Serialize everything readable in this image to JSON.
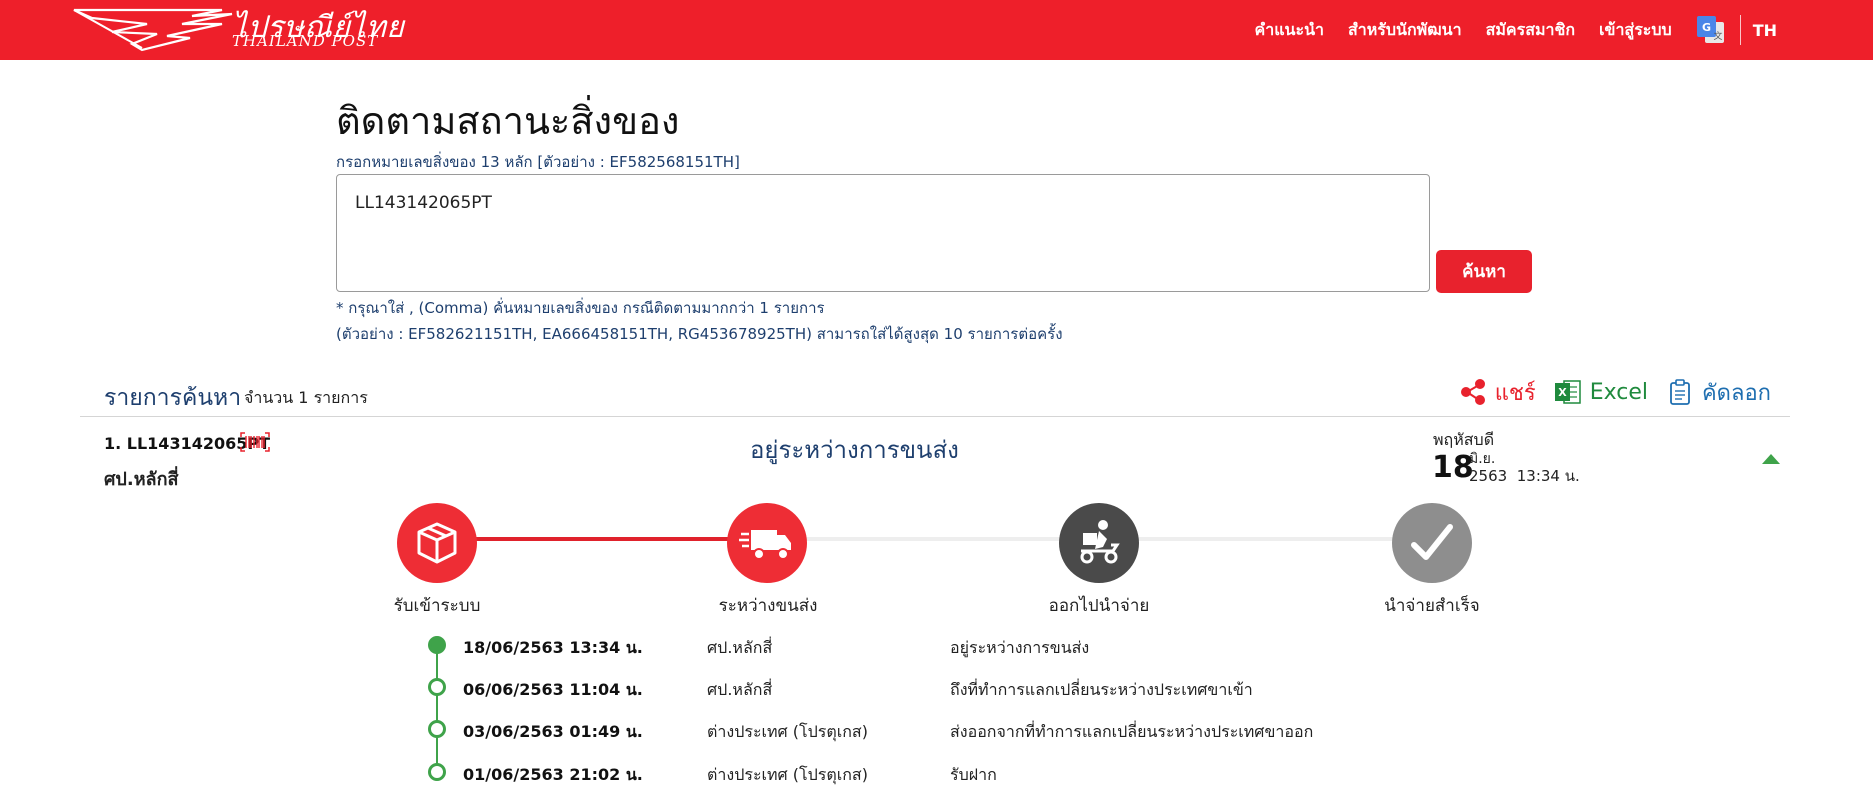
{
  "header": {
    "logo_th": "ไปรษณีย์ไทย",
    "logo_en": "THAILAND POST",
    "nav": [
      "คำแนะนำ",
      "สำหรับนักพัฒนา",
      "สมัครสมาชิก",
      "เข้าสู่ระบบ"
    ],
    "translate_icon": "google-translate-icon",
    "lang": "TH",
    "colors": {
      "brand_red": "#ee1f2a"
    }
  },
  "search": {
    "title": "ติดตามสถานะสิ่งของ",
    "hint": "กรอกหมายเลขสิ่งของ 13 หลัก [ตัวอย่าง : EF582568151TH]",
    "value": "LL143142065PT",
    "button": "ค้นหา",
    "note1": "* กรุณาใส่ , (Comma) คั่นหมายเลขสิ่งของ กรณีติดตามมากกว่า 1 รายการ",
    "note2": "(ตัวอย่าง : EF582621151TH, EA666458151TH, RG453678925TH) สามารถใส่ได้สูงสุด 10 รายการต่อครั้ง"
  },
  "results": {
    "title": "รายการค้นหา",
    "count": "จำนวน 1 รายการ",
    "actions": {
      "share": "แชร์",
      "excel": "Excel",
      "copy": "คัดลอก"
    }
  },
  "item": {
    "number": "1. LL143142065PT",
    "office": "ศป.หลักสี่",
    "status": "อยู่ระหว่างการขนส่ง",
    "date": {
      "day_of_week": "พฤหัสบดี",
      "day": "18",
      "month": "มิ.ย.",
      "year": "2563",
      "time": "13:34 น."
    },
    "steps": [
      {
        "label": "รับเข้าระบบ",
        "icon": "package-icon",
        "state": "done"
      },
      {
        "label": "ระหว่างขนส่ง",
        "icon": "delivery-truck-icon",
        "state": "current"
      },
      {
        "label": "ออกไปนำจ่าย",
        "icon": "delivery-scooter-icon",
        "state": "pending"
      },
      {
        "label": "นำจ่ายสำเร็จ",
        "icon": "checkmark-icon",
        "state": "pending"
      }
    ],
    "progress_fraction": 0.333,
    "events": [
      {
        "datetime": "18/06/2563 13:34 น.",
        "place": "ศป.หลักสี่",
        "description": "อยู่ระหว่างการขนส่ง"
      },
      {
        "datetime": "06/06/2563 11:04 น.",
        "place": "ศป.หลักสี่",
        "description": "ถึงที่ทำการแลกเปลี่ยนระหว่างประเทศขาเข้า"
      },
      {
        "datetime": "03/06/2563 01:49 น.",
        "place": "ต่างประเทศ (โปรตุเกส)",
        "description": "ส่งออกจากที่ทำการแลกเปลี่ยนระหว่างประเทศขาออก"
      },
      {
        "datetime": "01/06/2563 21:02 น.",
        "place": "ต่างประเทศ (โปรตุเกส)",
        "description": "รับฝาก"
      }
    ]
  }
}
